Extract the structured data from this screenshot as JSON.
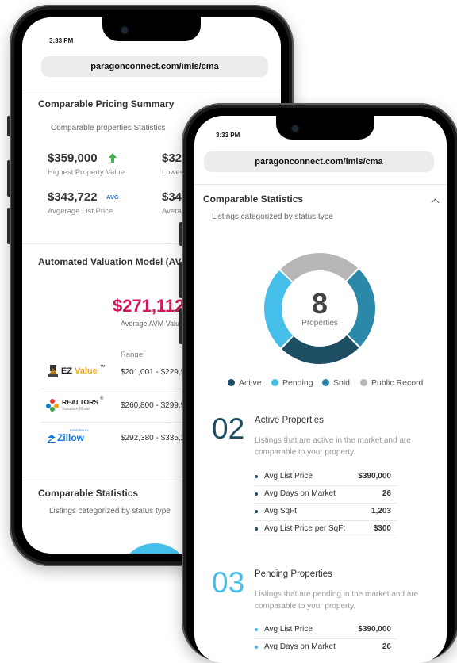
{
  "colors": {
    "active": "#1d4e63",
    "pending": "#45bfe9",
    "sold": "#2b88a8",
    "public_record": "#b7b7b7",
    "avm_value": "#d4175d",
    "up_arrow": "#3cb64a",
    "avg_badge": "#2a74c5",
    "ez_value": "#f2a71a",
    "zillow": "#1277e1"
  },
  "back_phone": {
    "time": "3:33 PM",
    "url": "paragonconnect.com/imls/cma",
    "pricing_summary": {
      "title": "Comparable Pricing Summary",
      "subtitle": "Comparable properties Statistics",
      "highest_value": "$359,000",
      "highest_label": "Highest Property Value",
      "lowest_value_partial": "$326",
      "lowest_label_partial": "Lowest",
      "avg_list_value": "$343,722",
      "avg_badge": "AVG",
      "avg_list_label": "Avgerage List Price",
      "avg_other_value_partial": "$346",
      "avg_other_label_partial": "Averag"
    },
    "avm": {
      "title": "Automated Valuation Model (AVM)",
      "value_partial": "$271,112",
      "value_label": "Average AVM Value",
      "range_header": "Range",
      "providers": [
        {
          "name_main": "EZ",
          "name_accent": "Value",
          "tm": "™",
          "range": "$201,001 - $229,5"
        },
        {
          "name_main": "REALTORS",
          "reg": "®",
          "tagline": "Valuation Model",
          "range": "$260,800 - $299,9"
        },
        {
          "tag": "POWERED BY",
          "name_main": "Zillow",
          "range": "$292,380 - $335,2"
        }
      ]
    },
    "comparable_statistics": {
      "title": "Comparable Statistics",
      "subtitle": "Listings categorized by status type"
    }
  },
  "front_phone": {
    "time": "3:33 PM",
    "url": "paragonconnect.com/imls/cma",
    "section_title": "Comparable Statistics",
    "section_subtitle": "Listings categorized by status type",
    "donut": {
      "total": "8",
      "total_label": "Properties",
      "segments": [
        {
          "name": "Active",
          "fraction": 0.25
        },
        {
          "name": "Pending",
          "fraction": 0.25
        },
        {
          "name": "Sold",
          "fraction": 0.25
        },
        {
          "name": "Public Record",
          "fraction": 0.25
        }
      ]
    },
    "legend": [
      "Active",
      "Pending",
      "Sold",
      "Public Record"
    ],
    "active": {
      "number": "02",
      "title": "Active Properties",
      "description": "Listings that are active in the market and are comparable to your property.",
      "stats": [
        {
          "label": "Avg List Price",
          "value": "$390,000"
        },
        {
          "label": "Avg Days on Market",
          "value": "26"
        },
        {
          "label": "Avg SqFt",
          "value": "1,203"
        },
        {
          "label": "Avg List Price per SqFt",
          "value": "$300"
        }
      ]
    },
    "pending": {
      "number": "03",
      "title": "Pending Properties",
      "description": "Listings that are pending in the market and are comparable to your property.",
      "stats": [
        {
          "label": "Avg List Price",
          "value": "$390,000"
        },
        {
          "label": "Avg Days on Market",
          "value": "26"
        }
      ]
    }
  }
}
